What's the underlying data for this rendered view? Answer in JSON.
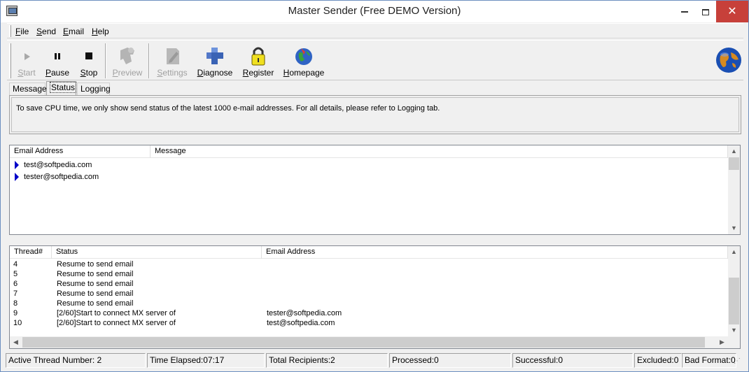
{
  "window": {
    "title": "Master Sender (Free DEMO Version)"
  },
  "menu": [
    "File",
    "Send",
    "Email",
    "Help"
  ],
  "toolbar": {
    "start": "Start",
    "pause": "Pause",
    "stop": "Stop",
    "preview": "Preview",
    "settings": "Settings",
    "diagnose": "Diagnose",
    "register": "Register",
    "homepage": "Homepage"
  },
  "tabs": [
    "Message",
    "Status",
    "Logging"
  ],
  "info_text": "To save CPU time, we only show send status of the latest 1000 e-mail addresses. For all details, please refer to Logging tab.",
  "email_list": {
    "headers": [
      "Email Address",
      "Message"
    ],
    "rows": [
      {
        "email": "test@softpedia.com",
        "message": ""
      },
      {
        "email": "tester@softpedia.com",
        "message": ""
      }
    ]
  },
  "thread_list": {
    "headers": [
      "Thread#",
      "Status",
      "Email Address"
    ],
    "rows": [
      {
        "thread": "4",
        "status": "Resume to send email",
        "email": ""
      },
      {
        "thread": "5",
        "status": "Resume to send email",
        "email": ""
      },
      {
        "thread": "6",
        "status": "Resume to send email",
        "email": ""
      },
      {
        "thread": "7",
        "status": "Resume to send email",
        "email": ""
      },
      {
        "thread": "8",
        "status": "Resume to send email",
        "email": ""
      },
      {
        "thread": "9",
        "status": "[2/60]Start to connect MX server of",
        "email": "tester@softpedia.com"
      },
      {
        "thread": "10",
        "status": "[2/60]Start to connect MX server of",
        "email": "test@softpedia.com"
      }
    ]
  },
  "statusbar": {
    "active_threads": "Active Thread Number: 2",
    "time_elapsed": "Time Elapsed:07:17",
    "total_recipients": "Total Recipients:2",
    "processed": "Processed:0",
    "successful": "Successful:0",
    "excluded": "Excluded:0",
    "bad_format": "Bad Format:0"
  },
  "colors": {
    "selection_arrow": "#0000c8",
    "close_button": "#c7403a",
    "window_border": "#6d8fc0"
  }
}
